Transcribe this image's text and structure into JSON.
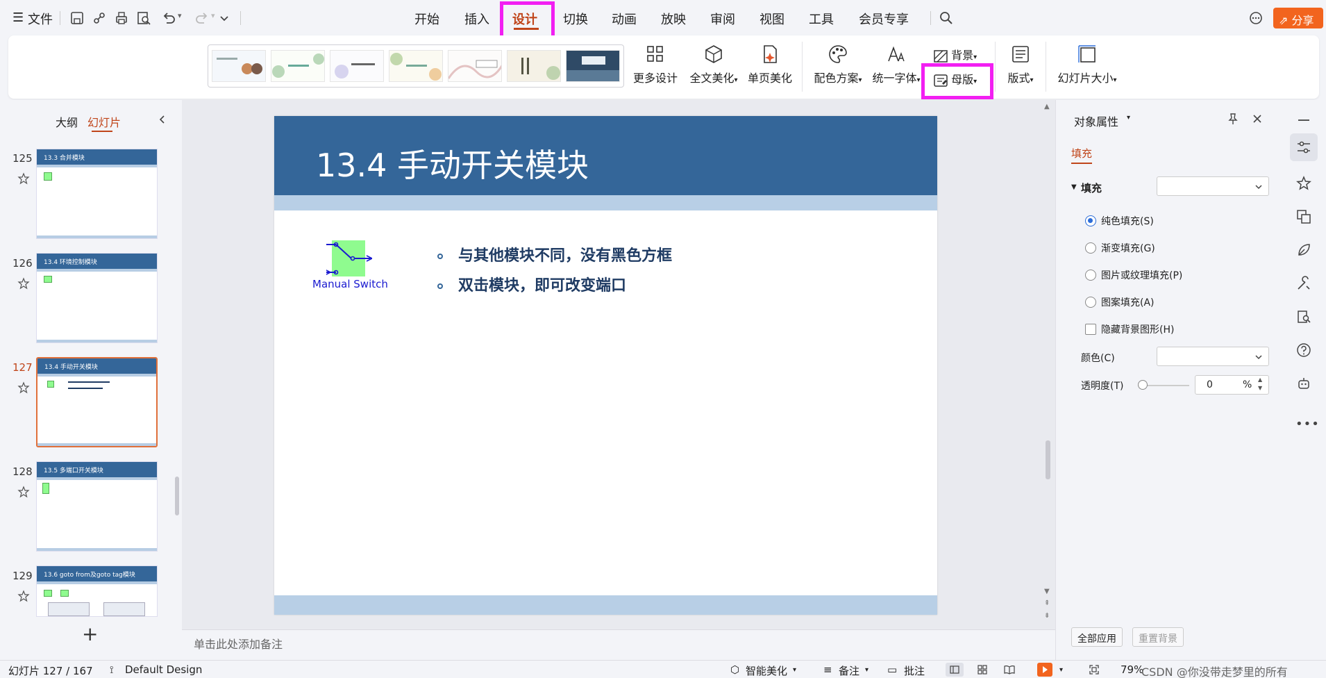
{
  "topbar": {
    "file_label": "文件",
    "tabs": [
      "开始",
      "插入",
      "设计",
      "切换",
      "动画",
      "放映",
      "审阅",
      "视图",
      "工具",
      "会员专享"
    ],
    "share_label": "分享"
  },
  "ribbon": {
    "more_design": "更多设计",
    "full_beautify": "全文美化",
    "single_beautify": "单页美化",
    "color_scheme": "配色方案",
    "unify_font": "统一字体",
    "background": "背景",
    "master": "母版",
    "layout": "版式",
    "slide_size": "幻灯片大小"
  },
  "left_panel": {
    "tab_outline": "大纲",
    "tab_slides": "幻灯片",
    "slides": [
      {
        "num": "125",
        "title": "13.3 合并模块"
      },
      {
        "num": "126",
        "title": "13.4 环境控制模块"
      },
      {
        "num": "127",
        "title": "13.4 手动开关模块"
      },
      {
        "num": "128",
        "title": "13.5 多端口开关模块"
      },
      {
        "num": "129",
        "title": "13.6 goto from及goto tag模块"
      }
    ]
  },
  "slide": {
    "title": "13.4 手动开关模块",
    "block_label": "Manual Switch",
    "bullets": [
      "与其他模块不同，没有黑色方框",
      "双击模块，即可改变端口"
    ]
  },
  "notes_placeholder": "单击此处添加备注",
  "right_panel": {
    "title": "对象属性",
    "tab_fill": "填充",
    "section_fill": "填充",
    "options": [
      "纯色填充(S)",
      "渐变填充(G)",
      "图片或纹理填充(P)",
      "图案填充(A)"
    ],
    "hide_bg": "隐藏背景图形(H)",
    "color_label": "颜色(C)",
    "transparency_label": "透明度(T)",
    "transparency_value": "0",
    "percent": "%",
    "apply_all": "全部应用",
    "reset_bg": "重置背景"
  },
  "statusbar": {
    "slide_count": "幻灯片 127 / 167",
    "theme": "Default Design",
    "smart_beautify": "智能美化",
    "notes": "备注",
    "comments": "批注",
    "zoom": "79%",
    "watermark": "CSDN @你没带走梦里的所有"
  },
  "colors": {
    "accent": "#c0451a",
    "slide_blue": "#346699",
    "highlight": "#f21ff2",
    "share": "#f2641e"
  }
}
